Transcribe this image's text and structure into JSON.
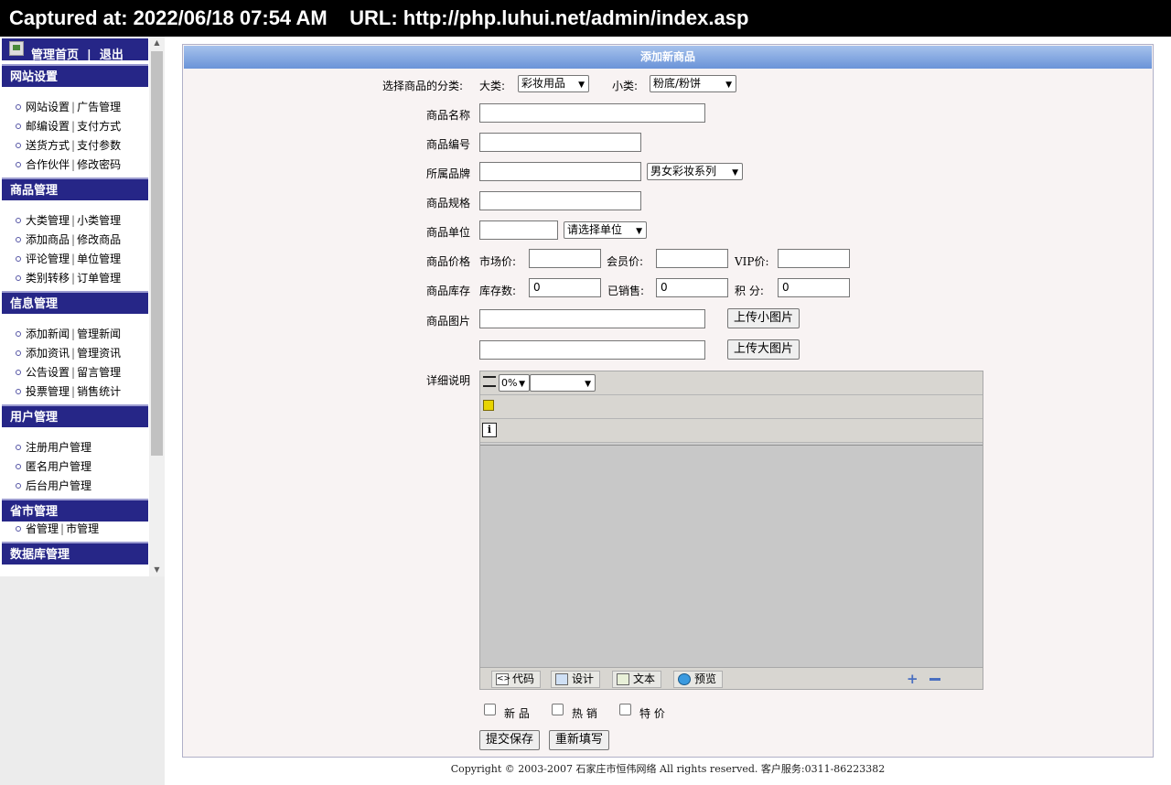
{
  "banner": {
    "text": "Captured at: 2022/06/18 07:54 AM    URL: http://php.luhui.net/admin/index.asp"
  },
  "sidebar": {
    "top_links": "管理首页  |  退出",
    "sections": [
      {
        "title": "网站设置",
        "items": [
          [
            "网站设置",
            "广告管理"
          ],
          [
            "邮编设置",
            "支付方式"
          ],
          [
            "送货方式",
            "支付参数"
          ],
          [
            "合作伙伴",
            "修改密码"
          ]
        ]
      },
      {
        "title": "商品管理",
        "items": [
          [
            "大类管理",
            "小类管理"
          ],
          [
            "添加商品",
            "修改商品"
          ],
          [
            "评论管理",
            "单位管理"
          ],
          [
            "类别转移",
            "订单管理"
          ]
        ]
      },
      {
        "title": "信息管理",
        "items": [
          [
            "添加新闻",
            "管理新闻"
          ],
          [
            "添加资讯",
            "管理资讯"
          ],
          [
            "公告设置",
            "留言管理"
          ],
          [
            "投票管理",
            "销售统计"
          ]
        ]
      },
      {
        "title": "用户管理",
        "items": [
          [
            "注册用户管理"
          ],
          [
            "匿名用户管理"
          ],
          [
            "后台用户管理"
          ]
        ]
      },
      {
        "title": "省市管理",
        "items": [
          [
            "省管理",
            "市管理"
          ]
        ]
      },
      {
        "title": "数据库管理",
        "items": []
      }
    ]
  },
  "form": {
    "title": "添加新商品",
    "category_label": "选择商品的分类:",
    "big_cat_label": "大类:",
    "big_cat_value": "彩妆用品",
    "small_cat_label": "小类:",
    "small_cat_value": "粉底/粉饼",
    "name_label": "商品名称",
    "code_label": "商品编号",
    "brand_label": "所属品牌",
    "brand_select": "男女彩妆系列",
    "spec_label": "商品规格",
    "unit_label": "商品单位",
    "unit_select": "请选择单位",
    "price_label": "商品价格",
    "market_price_label": "市场价:",
    "member_price_label": "会员价:",
    "vip_price_label": "VIP价:",
    "stock_label": "商品库存",
    "stock_count_label": "库存数:",
    "stock_count_value": "0",
    "sold_label": "已销售:",
    "sold_value": "0",
    "points_label": "积 分:",
    "points_value": "0",
    "image_label": "商品图片",
    "upload_small": "上传小图片",
    "upload_large": "上传大图片",
    "detail_label": "详细说明",
    "editor_zoom": "0%",
    "mode_code": "代码",
    "mode_design": "设计",
    "mode_text": "文本",
    "mode_preview": "预览",
    "chk_new": "新 品",
    "chk_hot": "热 销",
    "chk_special": "特 价",
    "submit": "提交保存",
    "reset": "重新填写"
  },
  "footer": {
    "copyright": "Copyright © 2003-2007 石家庄市恒伟网络 All rights reserved. 客户服务:0311-86223382"
  }
}
